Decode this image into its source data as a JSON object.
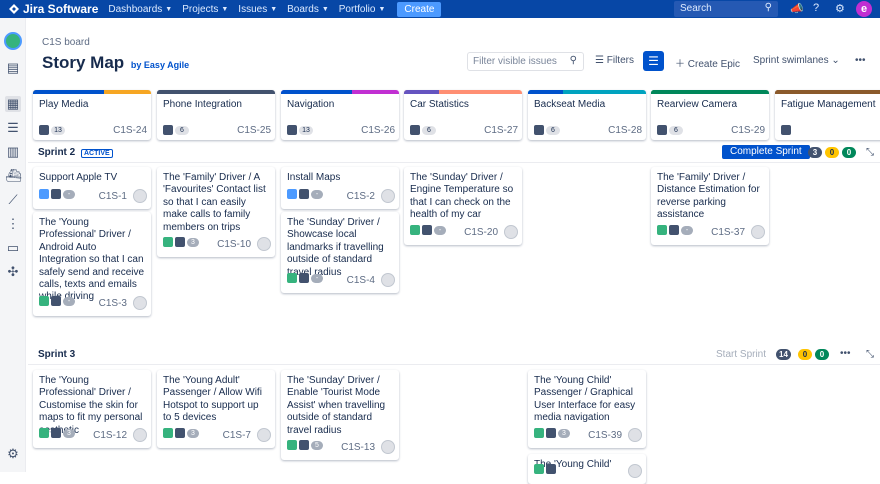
{
  "topnav": {
    "product": "Jira Software",
    "menu": [
      "Dashboards",
      "Projects",
      "Issues",
      "Boards",
      "Portfolio"
    ],
    "create_label": "Create",
    "search_placeholder": "Search",
    "avatar_letter": "e"
  },
  "header": {
    "breadcrumb": "C1S board",
    "title": "Story Map",
    "byline": "by Easy Agile",
    "filter_placeholder": "Filter visible issues",
    "filters_label": "Filters",
    "create_epic_label": "Create Epic",
    "swimlanes_label": "Sprint swimlanes",
    "more_label": "•••"
  },
  "epics": [
    {
      "name": "Play Media",
      "count": "13",
      "key": "C1S-24",
      "color": "#f6a623",
      "progress_color": "#0052cc",
      "progress": 0.6
    },
    {
      "name": "Phone Integration",
      "count": "6",
      "key": "C1S-25",
      "color": "#42526e",
      "progress_color": "#42526e",
      "progress": 0.3
    },
    {
      "name": "Navigation",
      "count": "13",
      "key": "C1S-26",
      "color": "#c12fd2",
      "progress_color": "#0052cc",
      "progress": 0.6
    },
    {
      "name": "Car Statistics",
      "count": "6",
      "key": "C1S-27",
      "color": "#ff8f73",
      "progress_color": "#6554c0",
      "progress": 0.3
    },
    {
      "name": "Backseat Media",
      "count": "6",
      "key": "C1S-28",
      "color": "#00a3bf",
      "progress_color": "#0052cc",
      "progress": 0.3
    },
    {
      "name": "Rearview Camera",
      "count": "6",
      "key": "C1S-29",
      "color": "#00875a",
      "progress_color": "#00875a",
      "progress": 0.3
    },
    {
      "name": "Fatigue Management",
      "count": "",
      "key": "",
      "color": "#8b5a2b",
      "progress_color": "#8b5a2b",
      "progress": 0.5
    }
  ],
  "sprints": [
    {
      "name": "Sprint 2",
      "status": "ACTIVE",
      "action": "Complete Sprint",
      "counts": [
        "3",
        "0",
        "0"
      ]
    },
    {
      "name": "Sprint 3",
      "status": "",
      "action": "Start Sprint",
      "counts": [
        "14",
        "0",
        "0"
      ]
    }
  ],
  "sprint2_cards": [
    {
      "text": "Support Apple TV",
      "key": "C1S-1",
      "type": "task",
      "pts": "-"
    },
    {
      "text": "The 'Young Professional' Driver / Android Auto Integration so that I can safely send and receive calls, texts and emails while driving",
      "key": "C1S-3",
      "type": "story",
      "pts": "-"
    },
    {
      "text": "The 'Family' Driver / A 'Favourites' Contact list so that I can easily make calls to family members on trips",
      "key": "C1S-10",
      "type": "story",
      "pts": "3"
    },
    {
      "text": "Install Maps",
      "key": "C1S-2",
      "type": "task",
      "pts": "-"
    },
    {
      "text": "The 'Sunday' Driver / Showcase local landmarks if travelling outside of standard travel radius",
      "key": "C1S-4",
      "type": "story",
      "pts": "-"
    },
    {
      "text": "The 'Sunday' Driver / Engine Temperature so that I can check on the health of my car",
      "key": "C1S-20",
      "type": "story",
      "pts": "-"
    },
    {
      "text": "The 'Family' Driver / Distance Estimation for reverse parking assistance",
      "key": "C1S-37",
      "type": "story",
      "pts": "-"
    }
  ],
  "sprint3_cards": [
    {
      "text": "The 'Young Professional' Driver / Customise the skin for maps to fit my personal aesthetic",
      "key": "C1S-12",
      "type": "story",
      "pts": "3"
    },
    {
      "text": "The 'Young Adult' Passenger / Allow Wifi Hotspot to support up to 5 devices",
      "key": "C1S-7",
      "type": "story",
      "pts": "3"
    },
    {
      "text": "The 'Sunday' Driver / Enable 'Tourist Mode Assist' when travelling outside of standard travel radius",
      "key": "C1S-13",
      "type": "story",
      "pts": "5"
    },
    {
      "text": "The 'Young Child' Passenger / Graphical User Interface for easy media navigation",
      "key": "C1S-39",
      "type": "story",
      "pts": "3"
    },
    {
      "text": "The 'Young Child'",
      "key": "",
      "type": "story",
      "pts": ""
    }
  ]
}
